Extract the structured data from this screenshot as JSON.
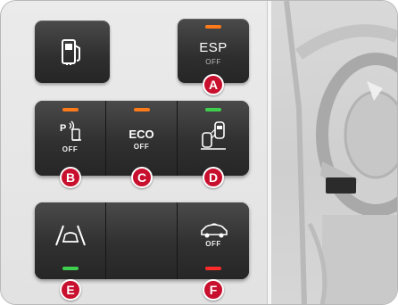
{
  "colors": {
    "led_orange": "#ff7a1a",
    "led_green": "#3fcf4f",
    "led_red": "#ff2b2b",
    "callout": "#c8102e"
  },
  "fuel_button": {
    "icon": "fuel-pump-icon"
  },
  "esp_button": {
    "label": "ESP",
    "sub_label": "OFF",
    "led": "orange",
    "callout": "A"
  },
  "top_row": {
    "park_sensor": {
      "icon": "parking-sensor-icon",
      "sub_label": "OFF",
      "led": "orange",
      "callout": "B"
    },
    "eco": {
      "label": "ECO",
      "sub_label": "OFF",
      "led": "orange",
      "callout": "C"
    },
    "blind_spot": {
      "icon": "blind-spot-monitor-icon",
      "led": "green",
      "callout": "D"
    }
  },
  "bottom_row": {
    "lane_departure": {
      "icon": "lane-departure-icon",
      "led": "green",
      "callout": "E"
    },
    "blank": {},
    "alarm": {
      "icon": "car-alarm-icon",
      "sub_label": "OFF",
      "led": "red",
      "callout": "F"
    }
  }
}
